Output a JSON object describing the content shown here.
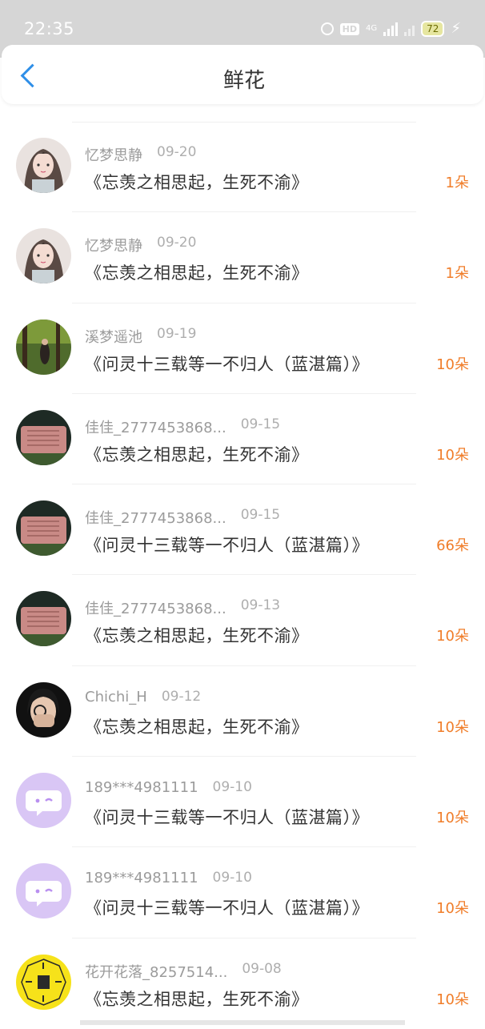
{
  "status_bar": {
    "time": "22:35",
    "hd": "HD",
    "network": "4G",
    "battery": "72"
  },
  "header": {
    "title": "鲜花",
    "back_icon": "chevron-left-icon"
  },
  "colors": {
    "accent": "#2f8fe8",
    "count": "#f07d29",
    "status_bar_bg": "#d6d6d6"
  },
  "items": [
    {
      "name": "忆梦思静",
      "date": "09-20",
      "title": "《忘羡之相思起，生死不渝》",
      "count": "1朵",
      "avatar": "avatar-girl-illustration"
    },
    {
      "name": "忆梦思静",
      "date": "09-20",
      "title": "《忘羡之相思起，生死不渝》",
      "count": "1朵",
      "avatar": "avatar-girl-illustration"
    },
    {
      "name": "溪梦遥池",
      "date": "09-19",
      "title": "《问灵十三载等一不归人（蓝湛篇）》",
      "count": "10朵",
      "avatar": "avatar-forest-photo"
    },
    {
      "name": "佳佳_2777453868...",
      "date": "09-15",
      "title": "《忘羡之相思起，生死不渝》",
      "count": "10朵",
      "avatar": "avatar-stone-photo"
    },
    {
      "name": "佳佳_2777453868...",
      "date": "09-15",
      "title": "《问灵十三载等一不归人（蓝湛篇）》",
      "count": "66朵",
      "avatar": "avatar-stone-photo"
    },
    {
      "name": "佳佳_2777453868...",
      "date": "09-13",
      "title": "《忘羡之相思起，生死不渝》",
      "count": "10朵",
      "avatar": "avatar-stone-photo"
    },
    {
      "name": "Chichi_H",
      "date": "09-12",
      "title": "《忘羡之相思起，生死不渝》",
      "count": "10朵",
      "avatar": "avatar-person-photo"
    },
    {
      "name": "189***4981111",
      "date": "09-10",
      "title": "《问灵十三载等一不归人（蓝湛篇）》",
      "count": "10朵",
      "avatar": "avatar-default-chat-icon"
    },
    {
      "name": "189***4981111",
      "date": "09-10",
      "title": "《问灵十三载等一不归人（蓝湛篇）》",
      "count": "10朵",
      "avatar": "avatar-default-chat-icon"
    },
    {
      "name": "花开花落_8257514...",
      "date": "09-08",
      "title": "《忘羡之相思起，生死不渝》",
      "count": "10朵",
      "avatar": "avatar-yellow-bagua"
    }
  ]
}
